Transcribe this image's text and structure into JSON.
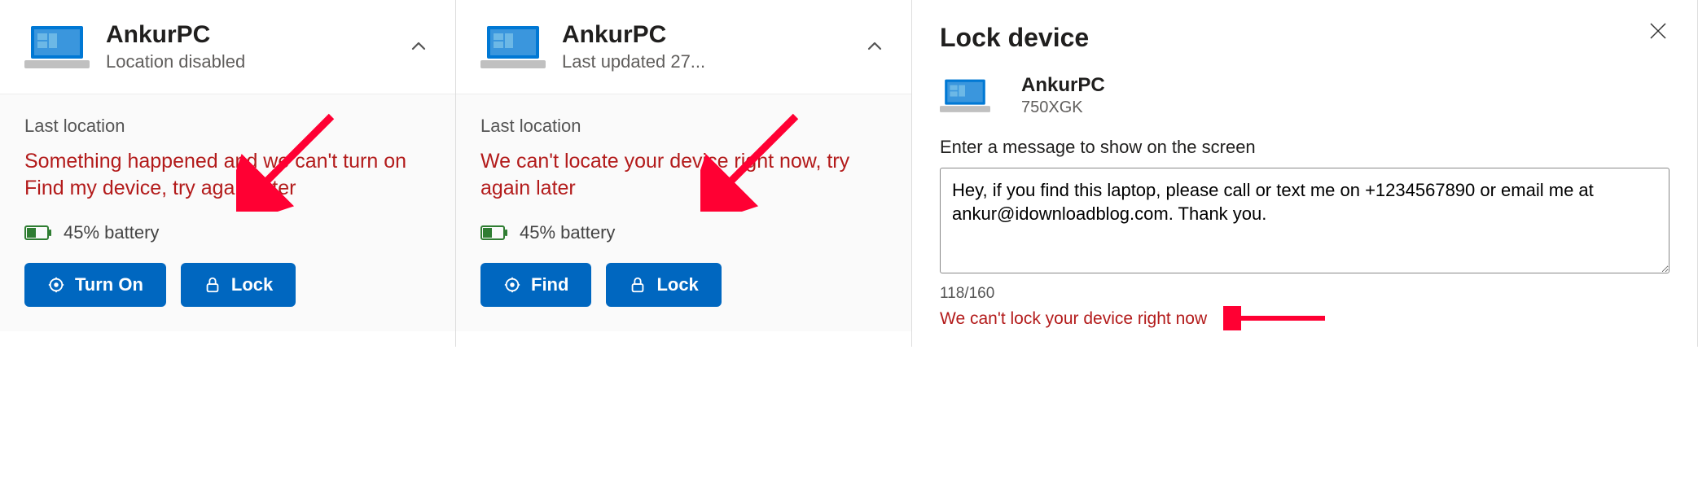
{
  "panelA": {
    "device_name": "AnkurPC",
    "device_status": "Location disabled",
    "section_label": "Last location",
    "error_text": "Something happened and we can't turn on Find my device, try again later",
    "battery_text": "45% battery",
    "primary_btn": "Turn On",
    "secondary_btn": "Lock"
  },
  "panelB": {
    "device_name": "AnkurPC",
    "device_status": "Last updated 27...",
    "section_label": "Last location",
    "error_text": "We can't locate your device right now, try again later",
    "battery_text": "45% battery",
    "primary_btn": "Find",
    "secondary_btn": "Lock"
  },
  "panelC": {
    "title": "Lock device",
    "device_name": "AnkurPC",
    "device_model": "750XGK",
    "field_label": "Enter a message to show on the screen",
    "message_value": "Hey, if you find this laptop, please call or text me on +1234567890 or email me at ankur@idownloadblog.com. Thank you.",
    "counter": "118/160",
    "error_text": "We can't lock your device right now"
  },
  "colors": {
    "error": "#b31b1b",
    "primary": "#0067c0",
    "arrow": "#ff0033"
  }
}
